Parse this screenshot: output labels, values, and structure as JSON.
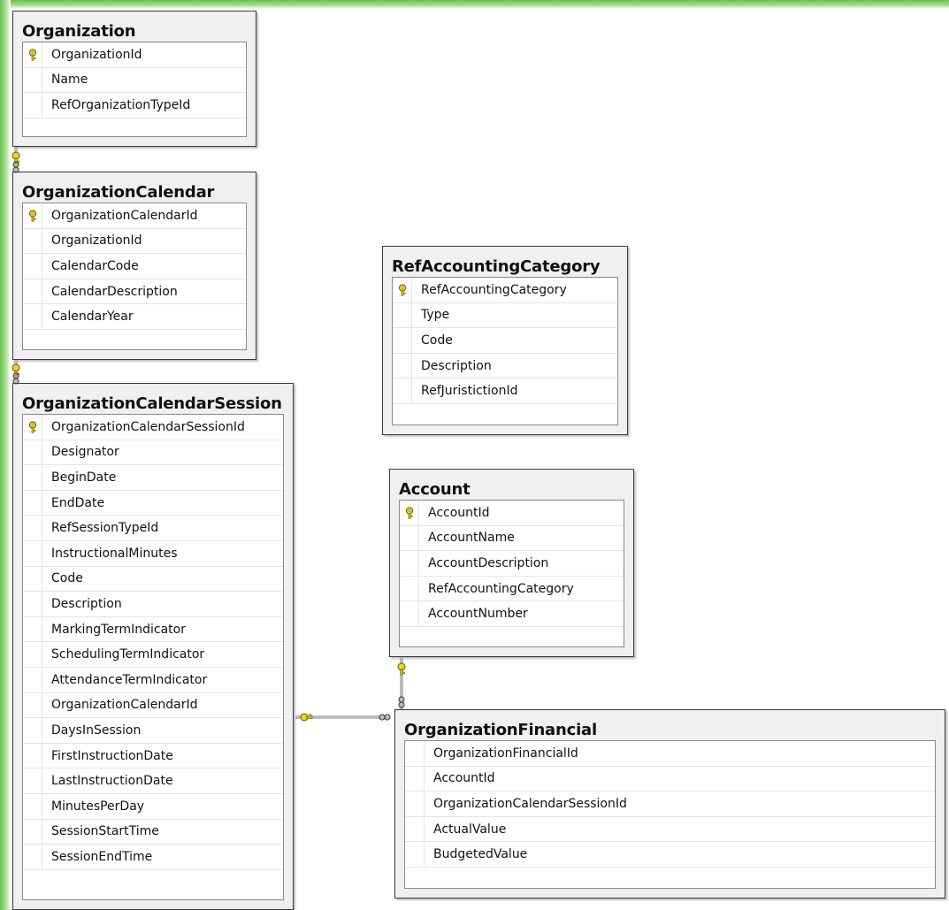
{
  "tables": {
    "organization": {
      "title": "Organization",
      "columns": [
        {
          "name": "OrganizationId",
          "key": true
        },
        {
          "name": "Name",
          "key": false
        },
        {
          "name": "RefOrganizationTypeId",
          "key": false
        }
      ]
    },
    "organization_calendar": {
      "title": "OrganizationCalendar",
      "columns": [
        {
          "name": "OrganizationCalendarId",
          "key": true
        },
        {
          "name": "OrganizationId",
          "key": false
        },
        {
          "name": "CalendarCode",
          "key": false
        },
        {
          "name": "CalendarDescription",
          "key": false
        },
        {
          "name": "CalendarYear",
          "key": false
        }
      ]
    },
    "organization_calendar_session": {
      "title": "OrganizationCalendarSession",
      "columns": [
        {
          "name": "OrganizationCalendarSessionId",
          "key": true
        },
        {
          "name": "Designator",
          "key": false
        },
        {
          "name": "BeginDate",
          "key": false
        },
        {
          "name": "EndDate",
          "key": false
        },
        {
          "name": "RefSessionTypeId",
          "key": false
        },
        {
          "name": "InstructionalMinutes",
          "key": false
        },
        {
          "name": "Code",
          "key": false
        },
        {
          "name": "Description",
          "key": false
        },
        {
          "name": "MarkingTermIndicator",
          "key": false
        },
        {
          "name": "SchedulingTermIndicator",
          "key": false
        },
        {
          "name": "AttendanceTermIndicator",
          "key": false
        },
        {
          "name": "OrganizationCalendarId",
          "key": false
        },
        {
          "name": "DaysInSession",
          "key": false
        },
        {
          "name": "FirstInstructionDate",
          "key": false
        },
        {
          "name": "LastInstructionDate",
          "key": false
        },
        {
          "name": "MinutesPerDay",
          "key": false
        },
        {
          "name": "SessionStartTime",
          "key": false
        },
        {
          "name": "SessionEndTime",
          "key": false
        }
      ]
    },
    "ref_accounting_category": {
      "title": "RefAccountingCategory",
      "columns": [
        {
          "name": "RefAccountingCategory",
          "key": true
        },
        {
          "name": "Type",
          "key": false
        },
        {
          "name": "Code",
          "key": false
        },
        {
          "name": "Description",
          "key": false
        },
        {
          "name": "RefJuristictionId",
          "key": false
        }
      ]
    },
    "account": {
      "title": "Account",
      "columns": [
        {
          "name": "AccountId",
          "key": true
        },
        {
          "name": "AccountName",
          "key": false
        },
        {
          "name": "AccountDescription",
          "key": false
        },
        {
          "name": "RefAccountingCategory",
          "key": false
        },
        {
          "name": "AccountNumber",
          "key": false
        }
      ]
    },
    "organization_financial": {
      "title": "OrganizationFinancial",
      "columns": [
        {
          "name": "OrganizationFinancialId",
          "key": false
        },
        {
          "name": "AccountId",
          "key": false
        },
        {
          "name": "OrganizationCalendarSessionId",
          "key": false
        },
        {
          "name": "ActualValue",
          "key": false
        },
        {
          "name": "BudgetedValue",
          "key": false
        }
      ]
    }
  },
  "relationships": [
    {
      "from": "organization",
      "to": "organization_calendar",
      "one_end": "key-icon",
      "many_end": "infinity-icon"
    },
    {
      "from": "organization_calendar",
      "to": "organization_calendar_session",
      "one_end": "key-icon",
      "many_end": "infinity-icon"
    },
    {
      "from": "organization_calendar_session",
      "to": "organization_financial",
      "one_end": "key-icon",
      "many_end": "infinity-icon"
    },
    {
      "from": "account",
      "to": "organization_financial",
      "one_end": "key-icon",
      "many_end": "infinity-icon"
    }
  ],
  "colors": {
    "frame_accent": "#6cc04a",
    "table_header_bg": "#f0f0f0",
    "table_border": "#3a3a3a",
    "key_fill": "#f2d21b",
    "key_stroke": "#6b5a00",
    "relationship_line": "#7a7a7a"
  }
}
